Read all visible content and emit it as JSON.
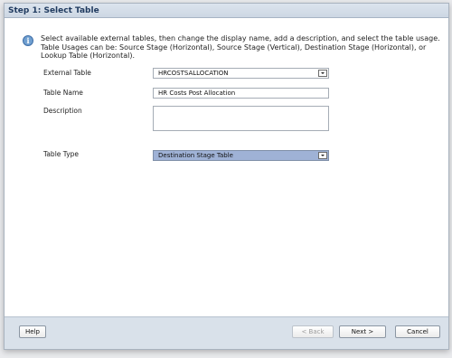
{
  "titlebar": {
    "title": "Step 1: Select Table"
  },
  "info": {
    "icon": "info-icon",
    "line1": "Select available external tables, then change the display name, add a description, and select the table usage.",
    "line2": "Table Usages can be: Source Stage (Horizontal), Source Stage (Vertical), Destination Stage (Horizontal), or",
    "line3": "Lookup Table (Horizontal)."
  },
  "form": {
    "external_table_label": "External Table",
    "external_table_value": "HRCOSTSALLOCATION",
    "table_name_label": "Table Name",
    "table_name_value": "HR Costs Post Allocation",
    "description_label": "Description",
    "description_value": "",
    "table_type_label": "Table Type",
    "table_type_value": "Destination Stage Table"
  },
  "buttons": {
    "help": "Help",
    "back": "< Back",
    "next": "Next >",
    "cancel": "Cancel"
  },
  "colors": {
    "selected_combo_bg": "#9fb2d6",
    "title_text": "#1f3a5f",
    "footer_bg": "#d9e1ea"
  }
}
